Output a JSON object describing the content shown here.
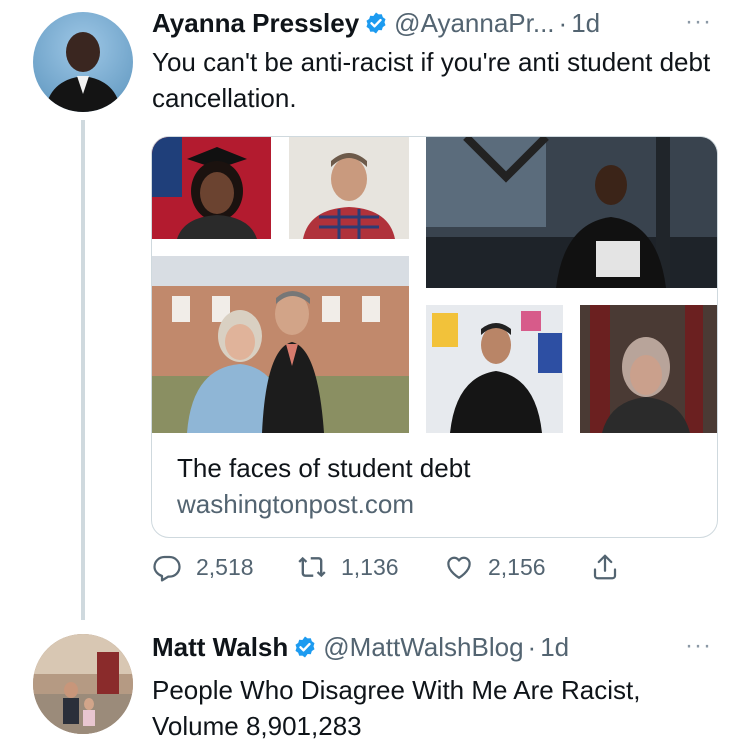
{
  "tweet1": {
    "author_name": "Ayanna Pressley",
    "handle": "@AyannaPr...",
    "dot": "·",
    "time": "1d",
    "more": "···",
    "text": "You can't be anti-racist if you're anti student debt cancellation.",
    "card": {
      "title": "The faces of student debt",
      "domain": "washingtonpost.com"
    },
    "actions": {
      "replies": "2,518",
      "retweets": "1,136",
      "likes": "2,156"
    }
  },
  "tweet2": {
    "author_name": "Matt Walsh",
    "handle": "@MattWalshBlog",
    "dot": "·",
    "time": "1d",
    "more": "···",
    "text": "People Who Disagree With Me Are Racist, Volume 8,901,283"
  },
  "icons": {
    "verified": "verified-badge-icon",
    "reply": "reply-icon",
    "retweet": "retweet-icon",
    "like": "heart-icon",
    "share": "share-icon",
    "more": "more-icon"
  },
  "colors": {
    "verified_blue": "#1d9bf0",
    "secondary_text": "#536471",
    "border": "#cfd9de"
  }
}
